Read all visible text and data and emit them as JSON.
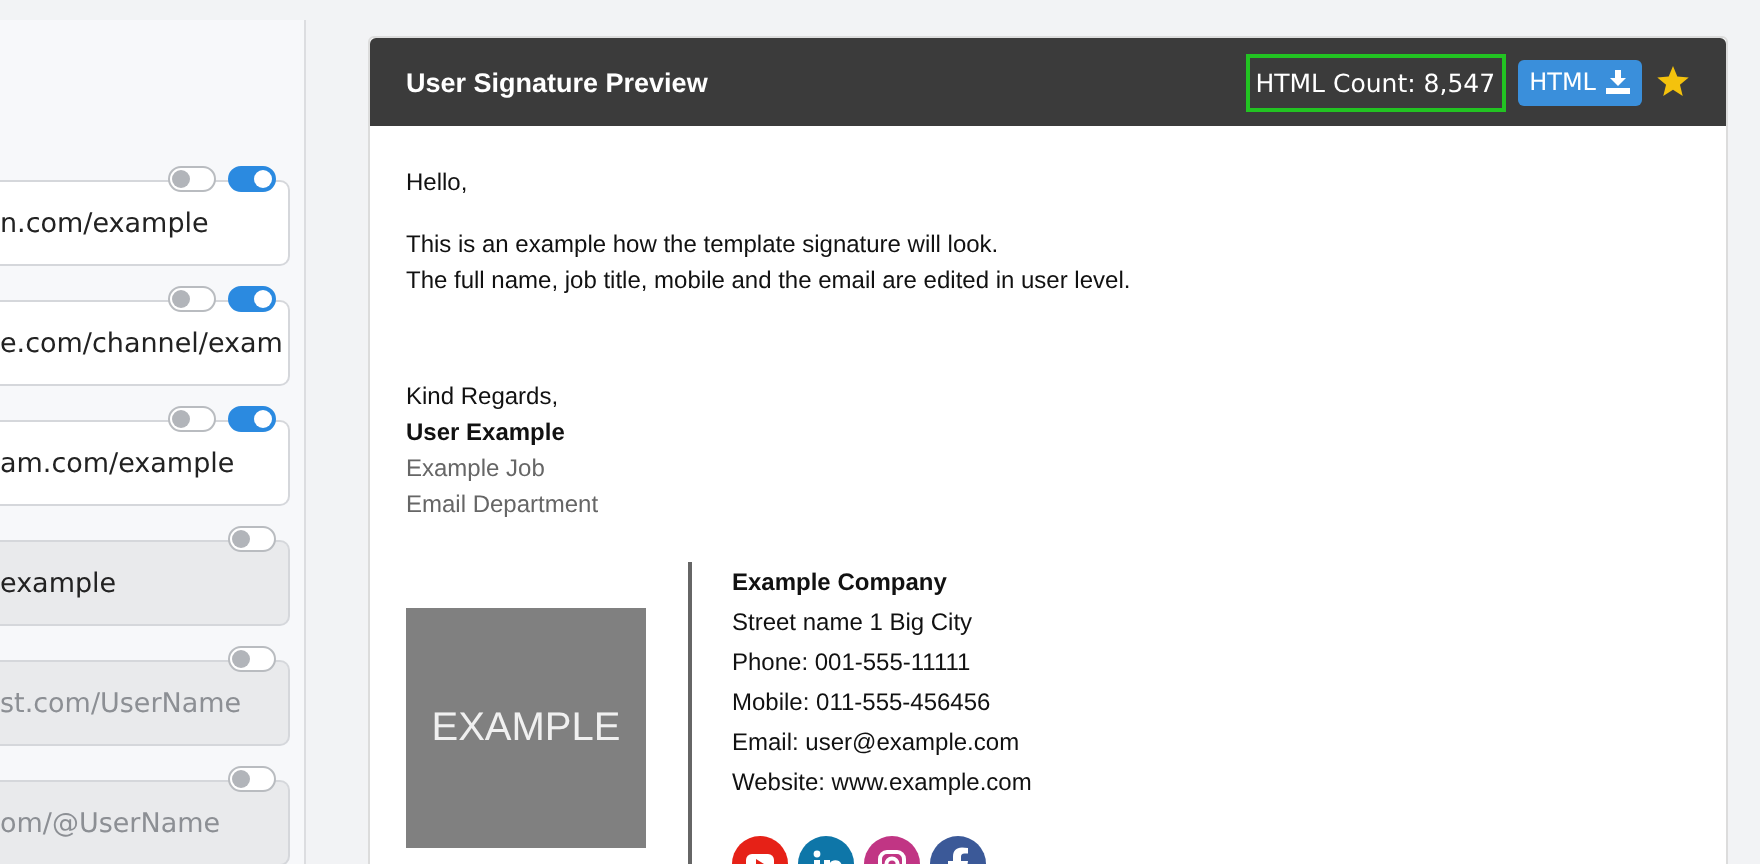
{
  "fields": [
    {
      "value": "n.com/example",
      "disabled": false,
      "toggles": [
        {
          "on": false
        },
        {
          "on": true
        }
      ]
    },
    {
      "value": "e.com/channel/exam",
      "disabled": false,
      "toggles": [
        {
          "on": false
        },
        {
          "on": true
        }
      ]
    },
    {
      "value": "am.com/example",
      "disabled": false,
      "toggles": [
        {
          "on": false
        },
        {
          "on": true
        }
      ]
    },
    {
      "value": "example",
      "disabled": true,
      "toggles": [
        {
          "on": false
        }
      ]
    },
    {
      "placeholder": "st.com/UserName",
      "disabled": true,
      "toggles": [
        {
          "on": false
        }
      ]
    },
    {
      "placeholder": "om/@UserName",
      "disabled": true,
      "toggles": [
        {
          "on": false
        }
      ]
    }
  ],
  "preview": {
    "title": "User Signature Preview",
    "html_count": "HTML Count: 8,547",
    "download_label": "HTML",
    "starred": true,
    "greeting": "Hello,",
    "intro_lines": [
      "This is an example how the template signature will look.",
      "The full name, job title, mobile and the email are edited in user level."
    ],
    "closing": "Kind Regards,",
    "name": "User Example",
    "job": "Example Job",
    "department": "Email Department",
    "logo_text": "EXAMPLE",
    "company": "Example Company",
    "details": [
      "Street name 1 Big City",
      "Phone: 001-555-11111",
      "Mobile: 011-555-456456",
      "Email: user@example.com",
      "Website: www.example.com"
    ],
    "social": [
      {
        "kind": "youtube",
        "color": "#e62117"
      },
      {
        "kind": "linkedin",
        "color": "#0e76a8"
      },
      {
        "kind": "instagram",
        "color": "#c13584"
      },
      {
        "kind": "facebook",
        "color": "#3b5998"
      }
    ]
  }
}
